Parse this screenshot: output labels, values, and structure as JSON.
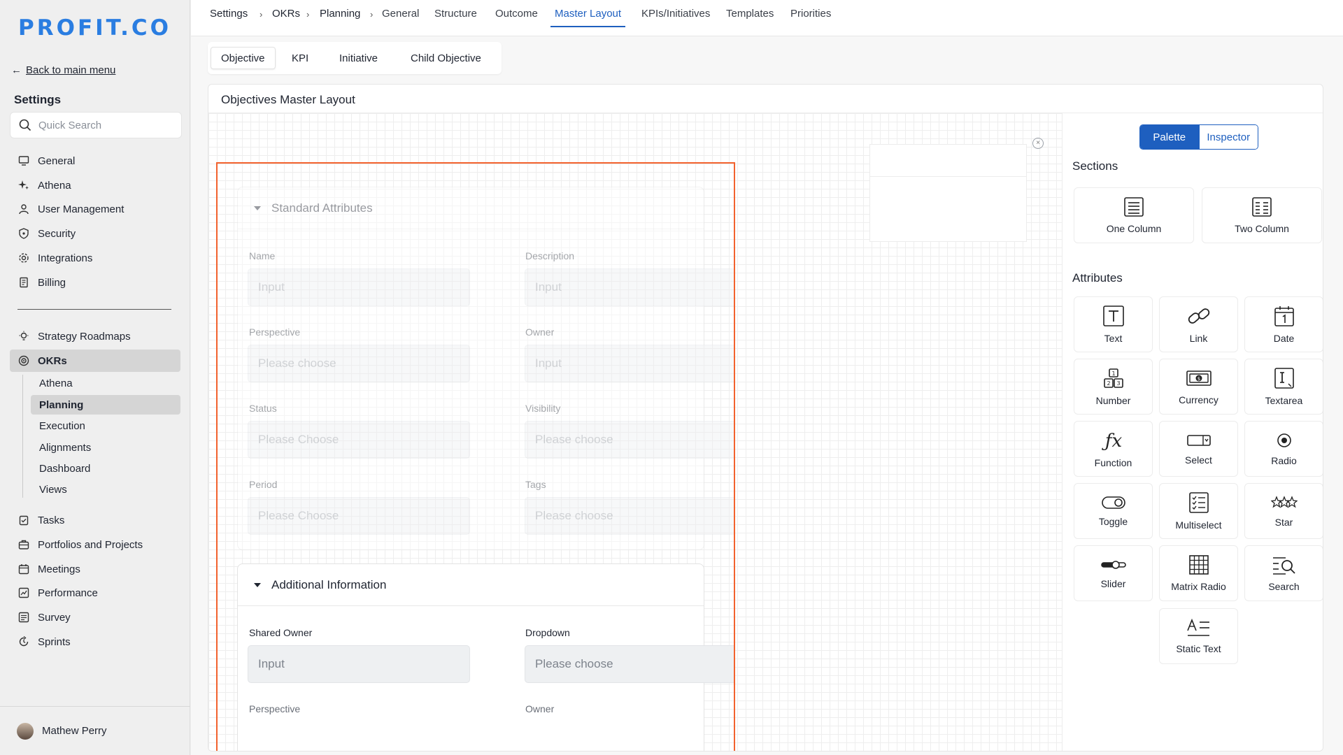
{
  "brand": {
    "logo": "PROFIT.CO",
    "color": "#2a7de1"
  },
  "sidebar": {
    "back_label": "Back to main menu",
    "title": "Settings",
    "search_placeholder": "Quick Search",
    "items_top": [
      {
        "label": "General",
        "icon": "monitor-icon"
      },
      {
        "label": "Athena",
        "icon": "sparkle-icon"
      },
      {
        "label": "User Management",
        "icon": "user-icon"
      },
      {
        "label": "Security",
        "icon": "shield-icon"
      },
      {
        "label": "Integrations",
        "icon": "gear-icon"
      },
      {
        "label": "Billing",
        "icon": "receipt-icon"
      }
    ],
    "items_mid": [
      {
        "label": "Strategy Roadmaps",
        "icon": "bulb-icon"
      },
      {
        "label": "OKRs",
        "icon": "target-icon"
      }
    ],
    "okr_sub": [
      "Athena",
      "Planning",
      "Execution",
      "Alignments",
      "Dashboard",
      "Views"
    ],
    "items_bottom": [
      {
        "label": "Tasks",
        "icon": "clipboard-icon"
      },
      {
        "label": "Portfolios and Projects",
        "icon": "briefcase-icon"
      },
      {
        "label": "Meetings",
        "icon": "calendar-icon"
      },
      {
        "label": "Performance",
        "icon": "chart-icon"
      },
      {
        "label": "Survey",
        "icon": "list-icon"
      },
      {
        "label": "Sprints",
        "icon": "sprint-icon"
      }
    ],
    "user_name": "Mathew Perry"
  },
  "topnav": {
    "breadcrumb": [
      "Settings",
      "OKRs",
      "Planning"
    ],
    "tabs": [
      "General",
      "Structure",
      "Outcome",
      "Master Layout",
      "KPIs/Initiatives",
      "Templates",
      "Priorities"
    ],
    "active": "Master Layout"
  },
  "subtabs": {
    "items": [
      "Objective",
      "KPI",
      "Initiative",
      "Child Objective"
    ],
    "active": "Objective"
  },
  "card_title": "Objectives Master Layout",
  "form": {
    "standard": {
      "title": "Standard Attributes",
      "fields": [
        {
          "label": "Name",
          "placeholder": "Input"
        },
        {
          "label": "Description",
          "placeholder": "Input"
        },
        {
          "label": "Perspective",
          "placeholder": "Please choose"
        },
        {
          "label": "Owner",
          "placeholder": "Input"
        },
        {
          "label": "Status",
          "placeholder": "Please Choose"
        },
        {
          "label": "Visibility",
          "placeholder": "Please choose"
        },
        {
          "label": "Period",
          "placeholder": "Please Choose"
        },
        {
          "label": "Tags",
          "placeholder": "Please choose"
        }
      ]
    },
    "additional": {
      "title": "Additional Information",
      "fields": [
        {
          "label": "Shared Owner",
          "placeholder": "Input"
        },
        {
          "label": "Dropdown",
          "placeholder": "Please choose"
        },
        {
          "label": "Perspective",
          "placeholder": ""
        },
        {
          "label": "Owner",
          "placeholder": ""
        }
      ]
    }
  },
  "panel": {
    "toggle": {
      "palette": "Palette",
      "inspector": "Inspector",
      "active": "Palette"
    },
    "sections_title": "Sections",
    "sections": [
      {
        "label": "One Column",
        "icon": "one-column-icon"
      },
      {
        "label": "Two Column",
        "icon": "two-column-icon"
      }
    ],
    "attributes_title": "Attributes",
    "attributes": [
      {
        "label": "Text",
        "icon": "text-icon"
      },
      {
        "label": "Link",
        "icon": "link-icon"
      },
      {
        "label": "Date",
        "icon": "date-icon"
      },
      {
        "label": "Number",
        "icon": "number-icon"
      },
      {
        "label": "Currency",
        "icon": "currency-icon"
      },
      {
        "label": "Textarea",
        "icon": "textarea-icon"
      },
      {
        "label": "Function",
        "icon": "function-icon"
      },
      {
        "label": "Select",
        "icon": "select-icon"
      },
      {
        "label": "Radio",
        "icon": "radio-icon"
      },
      {
        "label": "Toggle",
        "icon": "toggle-icon"
      },
      {
        "label": "Multiselect",
        "icon": "multiselect-icon"
      },
      {
        "label": "Star",
        "icon": "star-icon"
      },
      {
        "label": "Slider",
        "icon": "slider-icon"
      },
      {
        "label": "Matrix Radio",
        "icon": "matrix-icon"
      },
      {
        "label": "Search",
        "icon": "search-icon"
      },
      {
        "label": "Static Text",
        "icon": "static-text-icon"
      }
    ]
  },
  "colors": {
    "accent": "#1e5fbf",
    "highlight": "#f2622e"
  }
}
